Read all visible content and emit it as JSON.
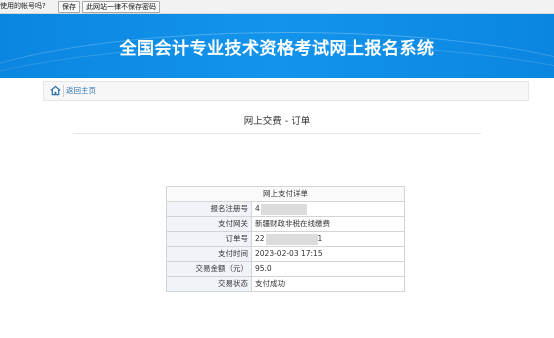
{
  "password_bar": {
    "message": "使用的帐号吗?",
    "save_label": "保存",
    "never_label": "此网站一律不保存密码"
  },
  "header": {
    "title": "全国会计专业技术资格考试网上报名系统"
  },
  "breadcrumb": {
    "home_label": "返回主页"
  },
  "page": {
    "title": "网上交费 - 订单"
  },
  "detail": {
    "caption": "网上支付详单",
    "rows": [
      {
        "label": "报名注册号",
        "prefix": "4",
        "suffix": "",
        "masked": true
      },
      {
        "label": "支付网关",
        "prefix": "新疆财政非税在线缴费",
        "suffix": "",
        "masked": false
      },
      {
        "label": "订单号",
        "prefix": "22",
        "suffix": "1",
        "masked": true
      },
      {
        "label": "支付时间",
        "prefix": "2023-02-03 17:15",
        "suffix": "",
        "masked": false
      },
      {
        "label": "交易金额（元）",
        "prefix": "95.0",
        "suffix": "",
        "masked": false
      },
      {
        "label": "交易状态",
        "prefix": "支付成功",
        "suffix": "",
        "masked": false
      }
    ]
  },
  "colors": {
    "banner": "#1394ec",
    "link": "#2a6fb0"
  }
}
